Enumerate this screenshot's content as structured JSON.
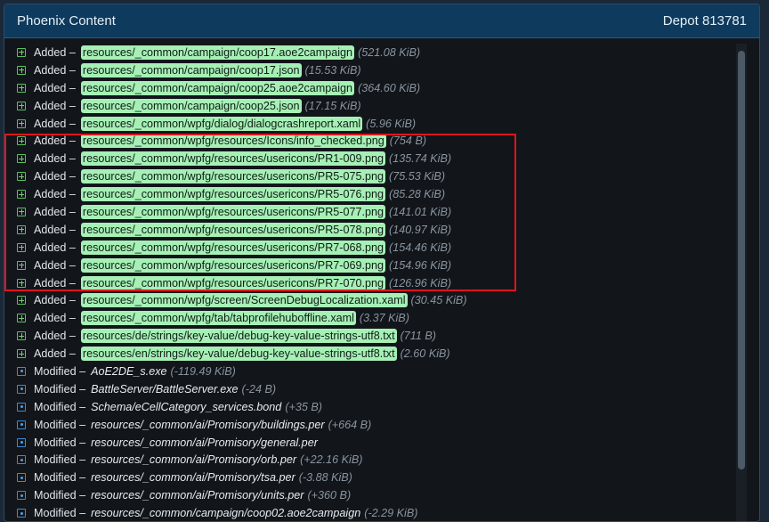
{
  "header": {
    "title": "Phoenix Content",
    "depot": "Depot 813781"
  },
  "rows": [
    {
      "type": "added",
      "verb": "Added –",
      "path": "resources/_common/campaign/coop17.aoe2campaign",
      "size": "(521.08 KiB)"
    },
    {
      "type": "added",
      "verb": "Added –",
      "path": "resources/_common/campaign/coop17.json",
      "size": "(15.53 KiB)"
    },
    {
      "type": "added",
      "verb": "Added –",
      "path": "resources/_common/campaign/coop25.aoe2campaign",
      "size": "(364.60 KiB)"
    },
    {
      "type": "added",
      "verb": "Added –",
      "path": "resources/_common/campaign/coop25.json",
      "size": "(17.15 KiB)"
    },
    {
      "type": "added",
      "verb": "Added –",
      "path": "resources/_common/wpfg/dialog/dialogcrashreport.xaml",
      "size": "(5.96 KiB)"
    },
    {
      "type": "added",
      "verb": "Added –",
      "path": "resources/_common/wpfg/resources/Icons/info_checked.png",
      "size": "(754 B)"
    },
    {
      "type": "added",
      "verb": "Added –",
      "path": "resources/_common/wpfg/resources/usericons/PR1-009.png",
      "size": "(135.74 KiB)"
    },
    {
      "type": "added",
      "verb": "Added –",
      "path": "resources/_common/wpfg/resources/usericons/PR5-075.png",
      "size": "(75.53 KiB)"
    },
    {
      "type": "added",
      "verb": "Added –",
      "path": "resources/_common/wpfg/resources/usericons/PR5-076.png",
      "size": "(85.28 KiB)"
    },
    {
      "type": "added",
      "verb": "Added –",
      "path": "resources/_common/wpfg/resources/usericons/PR5-077.png",
      "size": "(141.01 KiB)"
    },
    {
      "type": "added",
      "verb": "Added –",
      "path": "resources/_common/wpfg/resources/usericons/PR5-078.png",
      "size": "(140.97 KiB)"
    },
    {
      "type": "added",
      "verb": "Added –",
      "path": "resources/_common/wpfg/resources/usericons/PR7-068.png",
      "size": "(154.46 KiB)"
    },
    {
      "type": "added",
      "verb": "Added –",
      "path": "resources/_common/wpfg/resources/usericons/PR7-069.png",
      "size": "(154.96 KiB)"
    },
    {
      "type": "added",
      "verb": "Added –",
      "path": "resources/_common/wpfg/resources/usericons/PR7-070.png",
      "size": "(126.96 KiB)"
    },
    {
      "type": "added",
      "verb": "Added –",
      "path": "resources/_common/wpfg/screen/ScreenDebugLocalization.xaml",
      "size": "(30.45 KiB)"
    },
    {
      "type": "added",
      "verb": "Added –",
      "path": "resources/_common/wpfg/tab/tabprofilehuboffline.xaml",
      "size": "(3.37 KiB)"
    },
    {
      "type": "added",
      "verb": "Added –",
      "path": "resources/de/strings/key-value/debug-key-value-strings-utf8.txt",
      "size": "(711 B)"
    },
    {
      "type": "added",
      "verb": "Added –",
      "path": "resources/en/strings/key-value/debug-key-value-strings-utf8.txt",
      "size": "(2.60 KiB)"
    },
    {
      "type": "modified",
      "verb": "Modified –",
      "path": "AoE2DE_s.exe",
      "size": "(-119.49 KiB)"
    },
    {
      "type": "modified",
      "verb": "Modified –",
      "path": "BattleServer/BattleServer.exe",
      "size": "(-24 B)"
    },
    {
      "type": "modified",
      "verb": "Modified –",
      "path": "Schema/eCellCategory_services.bond",
      "size": "(+35 B)"
    },
    {
      "type": "modified",
      "verb": "Modified –",
      "path": "resources/_common/ai/Promisory/buildings.per",
      "size": "(+664 B)"
    },
    {
      "type": "modified",
      "verb": "Modified –",
      "path": "resources/_common/ai/Promisory/general.per",
      "size": ""
    },
    {
      "type": "modified",
      "verb": "Modified –",
      "path": "resources/_common/ai/Promisory/orb.per",
      "size": "(+22.16 KiB)"
    },
    {
      "type": "modified",
      "verb": "Modified –",
      "path": "resources/_common/ai/Promisory/tsa.per",
      "size": "(-3.88 KiB)"
    },
    {
      "type": "modified",
      "verb": "Modified –",
      "path": "resources/_common/ai/Promisory/units.per",
      "size": "(+360 B)"
    },
    {
      "type": "modified",
      "verb": "Modified –",
      "path": "resources/_common/campaign/coop02.aoe2campaign",
      "size": "(-2.29 KiB)"
    }
  ],
  "colors": {
    "header_bg": "#0e3a5d",
    "added_path_bg": "#a6f0b6",
    "added_icon": "#5ec05e",
    "modified_icon": "#3b8bd8",
    "highlight_border": "#e0141c"
  },
  "icons": {
    "added": "plus-square-icon",
    "modified": "dot-square-icon"
  }
}
